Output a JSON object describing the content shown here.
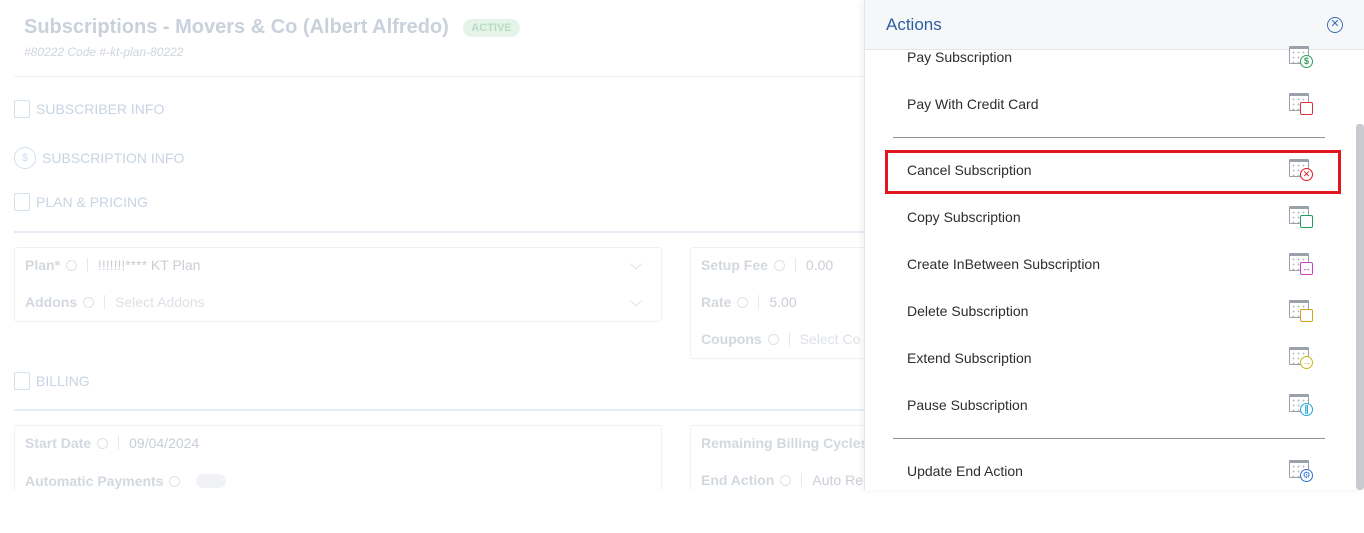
{
  "page": {
    "title": "Subscriptions - Movers & Co (Albert Alfredo)",
    "status": "ACTIVE",
    "subtitle": "#80222 Code #-kt-plan-80222",
    "sections": {
      "subscriber_info": "SUBSCRIBER INFO",
      "subscription_info": "SUBSCRIPTION INFO",
      "plan_pricing": "PLAN & PRICING",
      "billing": "BILLING"
    },
    "fields": {
      "plan_label": "Plan*",
      "plan_value": "!!!!!!!**** KT Plan",
      "addons_label": "Addons",
      "addons_placeholder": "Select Addons",
      "setup_fee_label": "Setup Fee",
      "setup_fee_value": "0.00",
      "rate_label": "Rate",
      "rate_value": "5.00",
      "coupons_label": "Coupons",
      "coupons_placeholder": "Select Co",
      "start_date_label": "Start Date",
      "start_date_value": "09/04/2024",
      "automatic_payments_label": "Automatic Payments",
      "remaining_cycles_label": "Remaining Billing Cycles",
      "end_action_label": "End Action",
      "end_action_value": "Auto Re"
    }
  },
  "panel": {
    "title": "Actions",
    "close_icon": "close-circle-icon",
    "groups": [
      [
        {
          "label": "Pay Subscription",
          "icon": "calendar-dollar-icon",
          "color": "#2e9e57"
        },
        {
          "label": "Pay With Credit Card",
          "icon": "calendar-credit-card-icon",
          "color": "#d8323c"
        }
      ],
      [
        {
          "label": "Cancel Subscription",
          "icon": "calendar-cancel-icon",
          "color": "#e0161e"
        },
        {
          "label": "Copy Subscription",
          "icon": "calendar-copy-icon",
          "color": "#1f9e5a"
        },
        {
          "label": "Create InBetween Subscription",
          "icon": "calendar-between-icon",
          "color": "#c445c4"
        },
        {
          "label": "Delete Subscription",
          "icon": "calendar-trash-icon",
          "color": "#d6a21a"
        },
        {
          "label": "Extend Subscription",
          "icon": "calendar-arrow-icon",
          "color": "#c9b51a"
        },
        {
          "label": "Pause Subscription",
          "icon": "calendar-pause-icon",
          "color": "#1ba4d8"
        }
      ],
      [
        {
          "label": "Update End Action",
          "icon": "calendar-gear-icon",
          "color": "#2f6fd0"
        }
      ]
    ]
  }
}
